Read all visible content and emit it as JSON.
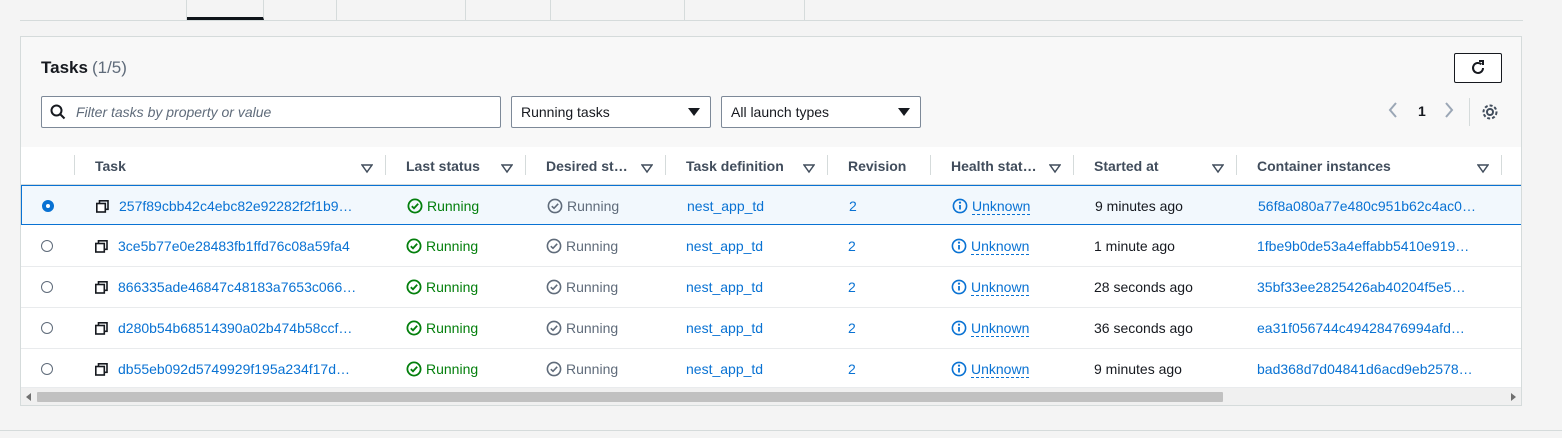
{
  "panel": {
    "title": "Tasks",
    "count": "(1/5)"
  },
  "filters": {
    "search_placeholder": "Filter tasks by property or value",
    "status_select": "Running tasks",
    "launch_select": "All launch types"
  },
  "pagination": {
    "current_page": "1"
  },
  "columns": [
    "Task",
    "Last status",
    "Desired st…",
    "Task definition",
    "Revision",
    "Health stat…",
    "Started at",
    "Container instances"
  ],
  "rows": [
    {
      "task": "257f89cbb42c4ebc82e92282f2f1b9…",
      "last_status": "Running",
      "desired_status": "Running",
      "task_definition": "nest_app_td",
      "revision": "2",
      "health": "Unknown",
      "started_at": "9 minutes ago",
      "container_instance": "56f8a080a77e480c951b62c4ac0…",
      "selected": true
    },
    {
      "task": "3ce5b77e0e28483fb1ffd76c08a59fa4",
      "last_status": "Running",
      "desired_status": "Running",
      "task_definition": "nest_app_td",
      "revision": "2",
      "health": "Unknown",
      "started_at": "1 minute ago",
      "container_instance": "1fbe9b0de53a4effabb5410e919…",
      "selected": false
    },
    {
      "task": "866335ade46847c48183a7653c066…",
      "last_status": "Running",
      "desired_status": "Running",
      "task_definition": "nest_app_td",
      "revision": "2",
      "health": "Unknown",
      "started_at": "28 seconds ago",
      "container_instance": "35bf33ee2825426ab40204f5e5…",
      "selected": false
    },
    {
      "task": "d280b54b68514390a02b474b58ccf…",
      "last_status": "Running",
      "desired_status": "Running",
      "task_definition": "nest_app_td",
      "revision": "2",
      "health": "Unknown",
      "started_at": "36 seconds ago",
      "container_instance": "ea31f056744c49428476994afd…",
      "selected": false
    },
    {
      "task": "db55eb092d5749929f195a234f17d…",
      "last_status": "Running",
      "desired_status": "Running",
      "task_definition": "nest_app_td",
      "revision": "2",
      "health": "Unknown",
      "started_at": "9 minutes ago",
      "container_instance": "bad368d7d04841d6acd9eb2578…",
      "selected": false
    }
  ],
  "colors": {
    "link": "#0972d3",
    "success": "#037f0c",
    "muted": "#5f6b7a"
  },
  "icons": {
    "refresh": "refresh-icon",
    "search": "search-icon",
    "settings": "gear-icon",
    "copy": "copy-icon",
    "running": "check-circle-icon",
    "desired": "check-circle-outline-icon",
    "info": "info-icon"
  }
}
